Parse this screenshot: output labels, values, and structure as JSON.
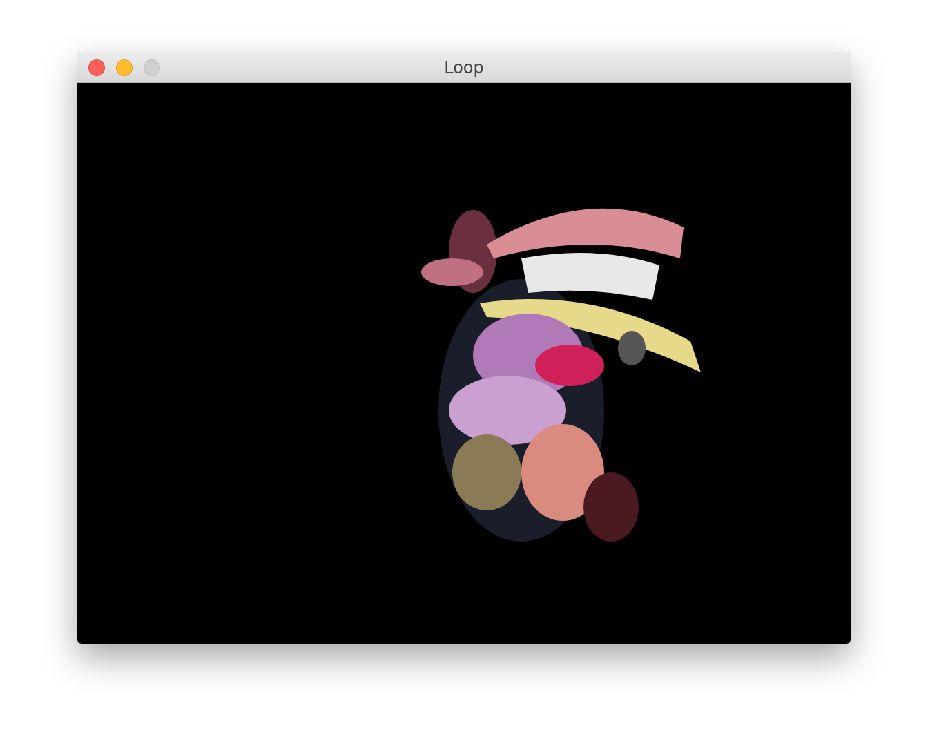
{
  "window": {
    "title": "Loop",
    "controls": [
      {
        "kind": "close",
        "disabled": false
      },
      {
        "kind": "minimize",
        "disabled": false
      },
      {
        "kind": "zoom",
        "disabled": true
      }
    ]
  }
}
